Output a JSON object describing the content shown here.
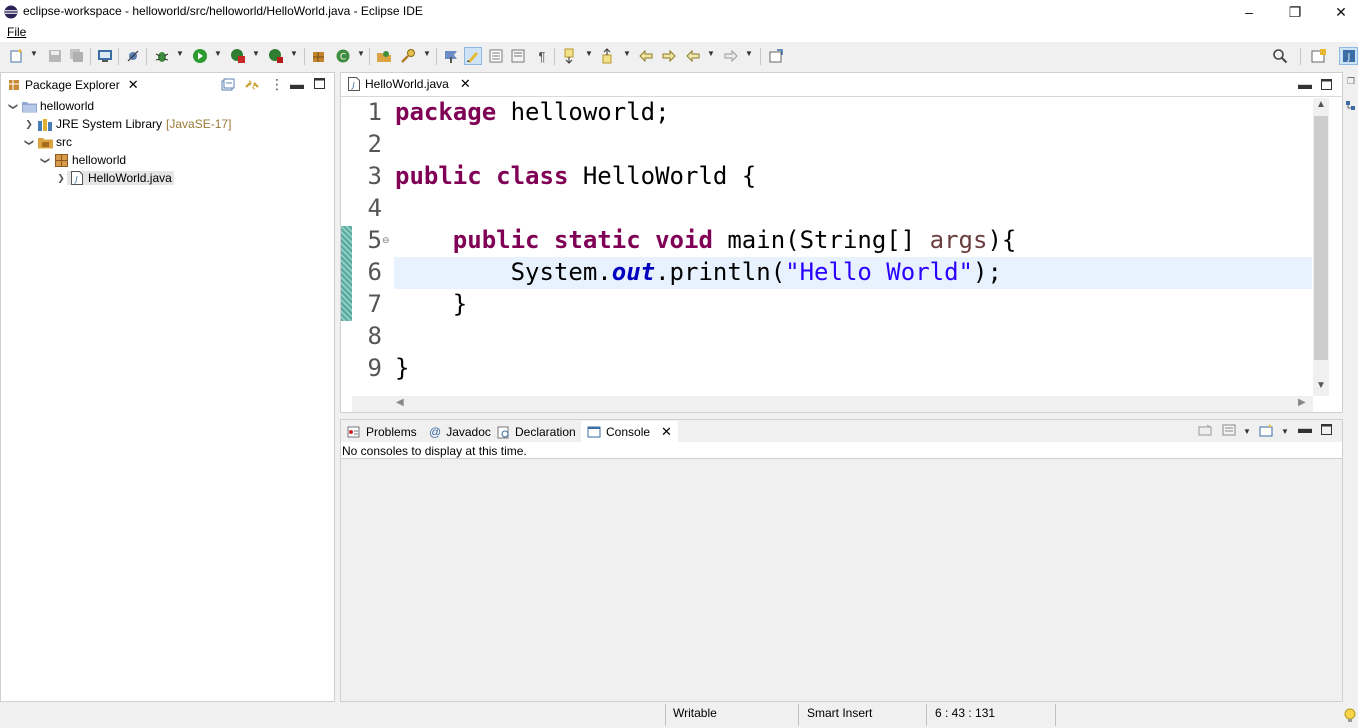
{
  "window": {
    "title": "eclipse-workspace - helloworld/src/helloworld/HelloWorld.java - Eclipse IDE",
    "minimize": "–",
    "maximize": "❐",
    "close": "✕"
  },
  "menu": {
    "file": "File"
  },
  "package_explorer": {
    "tab_label": "Package Explorer",
    "tree": [
      {
        "label": "helloworld",
        "icon": "project-icon"
      },
      {
        "label": "JRE System Library",
        "suffix": "[JavaSE-17]",
        "icon": "library-icon"
      },
      {
        "label": "src",
        "icon": "source-folder-icon"
      },
      {
        "label": "helloworld",
        "icon": "package-icon"
      },
      {
        "label": "HelloWorld.java",
        "icon": "java-file-icon"
      }
    ]
  },
  "editor": {
    "tab_label": "HelloWorld.java",
    "line_numbers": [
      "1",
      "2",
      "3",
      "4",
      "5",
      "6",
      "7",
      "8",
      "9"
    ],
    "code": {
      "l1_kw": "package",
      "l1_rest": " helloworld;",
      "l3_kw1": "public",
      "l3_kw2": "class",
      "l3_rest": " HelloWorld {",
      "l5_indent": "    ",
      "l5_kw1": "public",
      "l5_kw2": "static",
      "l5_kw3": "void",
      "l5_rest": " main(String[] ",
      "l5_param": "args",
      "l5_end": "){",
      "l6_a": "        System.",
      "l6_field": "out",
      "l6_b": ".println(",
      "l6_str": "\"Hello World\"",
      "l6_c": ");",
      "l7": "    }",
      "l9": "}"
    },
    "colors": {
      "keyword": "#7f0055",
      "string": "#2a00ff",
      "field": "#0000c0",
      "current_line": "#e8f2fe",
      "change_bar": "#5aa69c"
    }
  },
  "console_view": {
    "tabs": [
      "Problems",
      "Javadoc",
      "Declaration",
      "Console"
    ],
    "message": "No consoles to display at this time."
  },
  "status": {
    "writable": "Writable",
    "insert_mode": "Smart Insert",
    "position": "6 : 43 : 131"
  }
}
